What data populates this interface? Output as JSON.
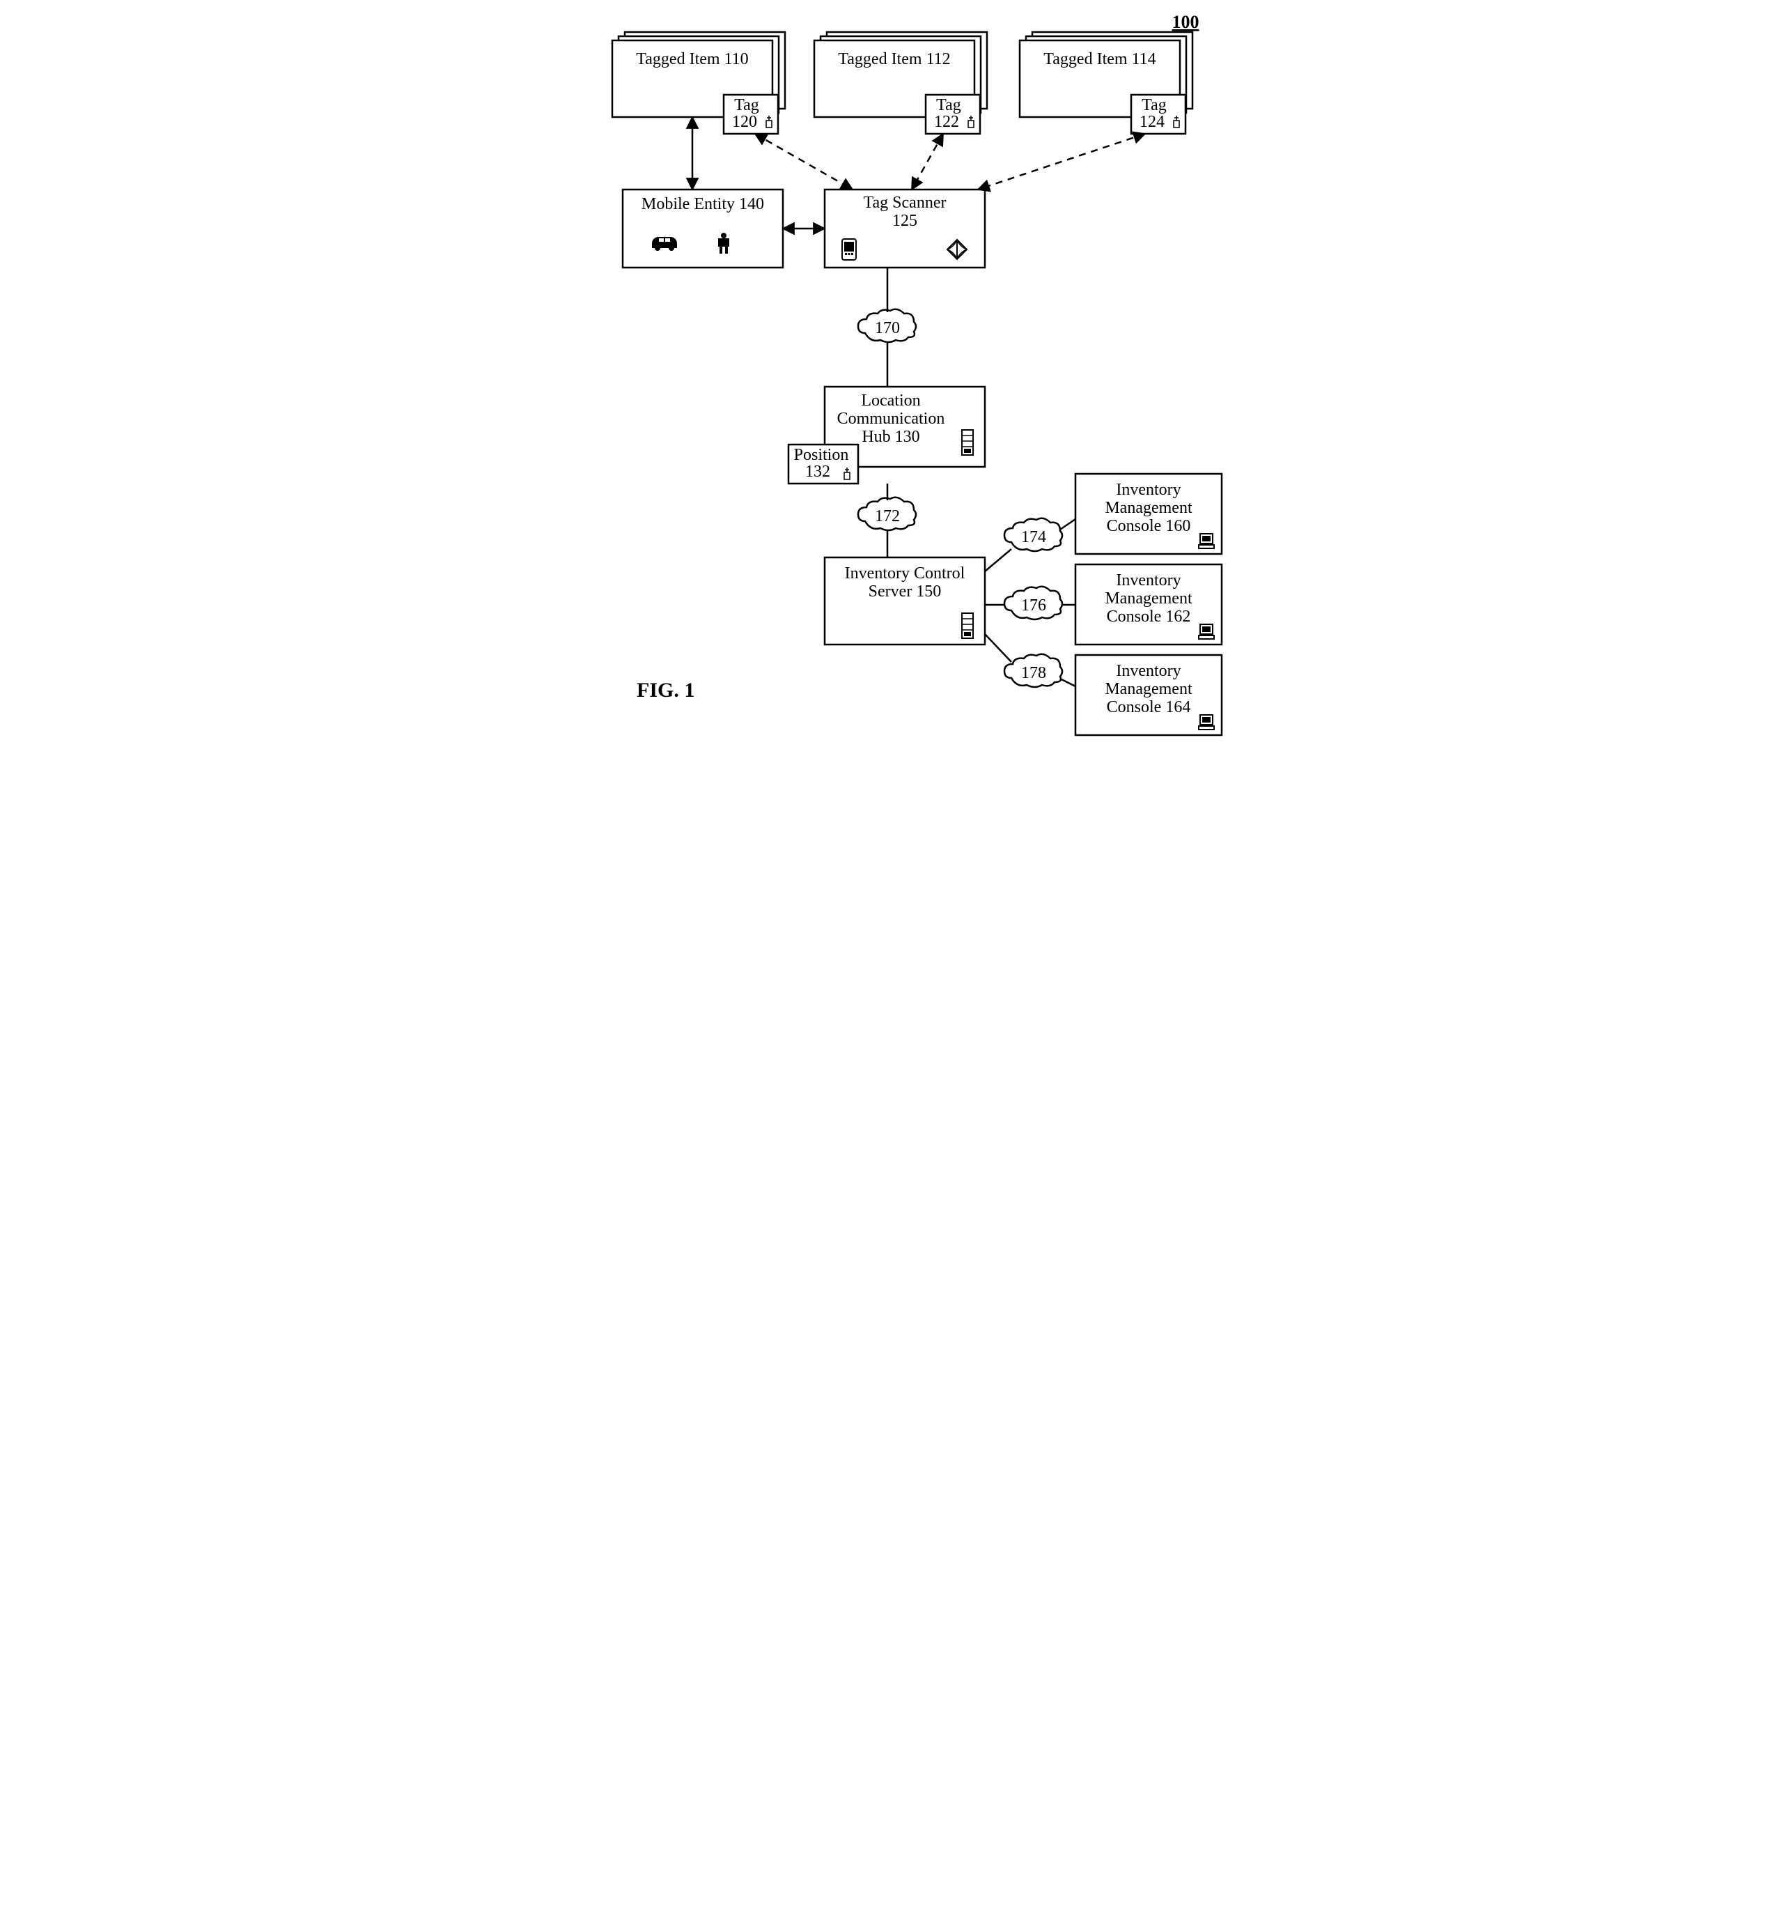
{
  "figure_number": "100",
  "figure_label": "FIG. 1",
  "nodes": {
    "tagged_item_110": {
      "label": "Tagged Item 110",
      "tag": "Tag\n120"
    },
    "tagged_item_112": {
      "label": "Tagged Item 112",
      "tag": "Tag\n122"
    },
    "tagged_item_114": {
      "label": "Tagged Item 114",
      "tag": "Tag\n124"
    },
    "mobile_entity": {
      "label": "Mobile Entity 140"
    },
    "tag_scanner": {
      "label": "Tag Scanner\n125"
    },
    "location_hub": {
      "label": "Location\nCommunication\nHub 130",
      "position": "Position\n132"
    },
    "inventory_server": {
      "label": "Inventory Control\nServer 150"
    },
    "console_160": {
      "label": "Inventory\nManagement\nConsole 160"
    },
    "console_162": {
      "label": "Inventory\nManagement\nConsole 162"
    },
    "console_164": {
      "label": "Inventory\nManagement\nConsole 164"
    },
    "cloud_170": "170",
    "cloud_172": "172",
    "cloud_174": "174",
    "cloud_176": "176",
    "cloud_178": "178"
  },
  "edges": [
    {
      "from": "tagged_item_110",
      "to": "mobile_entity",
      "style": "solid",
      "bidir": true
    },
    {
      "from": "tag_120",
      "to": "tag_scanner",
      "style": "dashed",
      "bidir": true
    },
    {
      "from": "tag_122",
      "to": "tag_scanner",
      "style": "dashed",
      "bidir": true
    },
    {
      "from": "tag_124",
      "to": "tag_scanner",
      "style": "dashed",
      "bidir": true
    },
    {
      "from": "mobile_entity",
      "to": "tag_scanner",
      "style": "solid",
      "bidir": true
    },
    {
      "from": "tag_scanner",
      "to": "cloud_170",
      "style": "solid"
    },
    {
      "from": "cloud_170",
      "to": "location_hub",
      "style": "solid"
    },
    {
      "from": "location_hub",
      "to": "cloud_172",
      "style": "solid"
    },
    {
      "from": "cloud_172",
      "to": "inventory_server",
      "style": "solid"
    },
    {
      "from": "inventory_server",
      "to": "cloud_174",
      "style": "solid"
    },
    {
      "from": "cloud_174",
      "to": "console_160",
      "style": "solid"
    },
    {
      "from": "inventory_server",
      "to": "cloud_176",
      "style": "solid"
    },
    {
      "from": "cloud_176",
      "to": "console_162",
      "style": "solid"
    },
    {
      "from": "inventory_server",
      "to": "cloud_178",
      "style": "solid"
    },
    {
      "from": "cloud_178",
      "to": "console_164",
      "style": "solid"
    }
  ]
}
